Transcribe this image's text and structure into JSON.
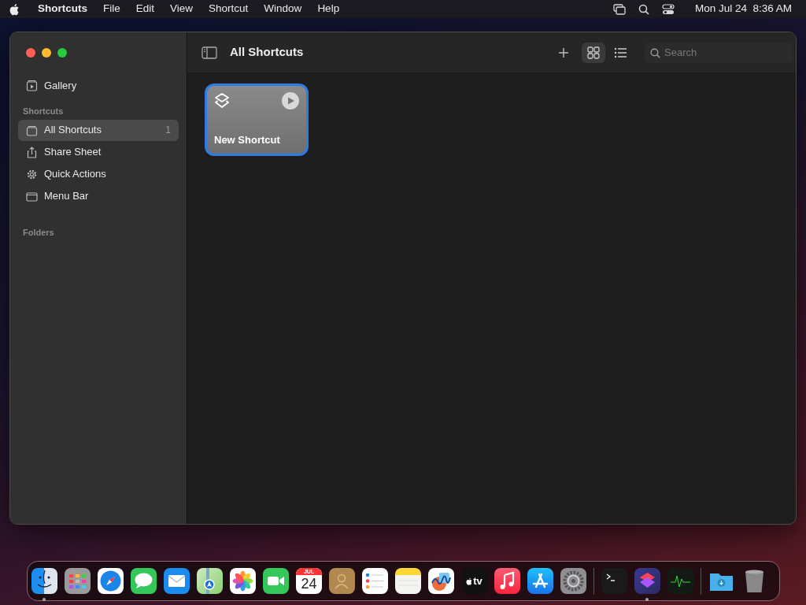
{
  "menu_bar": {
    "app": "Shortcuts",
    "menus": [
      "File",
      "Edit",
      "View",
      "Shortcut",
      "Window",
      "Help"
    ],
    "clock": "Mon Jul 24  8:36 AM"
  },
  "window": {
    "title": "All Shortcuts",
    "search": {
      "placeholder": "Search"
    },
    "view_modes": [
      {
        "kind": "grid",
        "selected": true
      },
      {
        "kind": "list",
        "selected": false
      }
    ]
  },
  "sidebar": [
    {
      "kind": "item",
      "label": "Gallery",
      "selected": false
    },
    {
      "kind": "heading",
      "label": "Shortcuts"
    },
    {
      "kind": "item",
      "label": "All Shortcuts",
      "count": "1",
      "selected": true
    },
    {
      "kind": "item",
      "label": "Share Sheet",
      "selected": false
    },
    {
      "kind": "item",
      "label": "Quick Actions",
      "selected": false
    },
    {
      "kind": "item",
      "label": "Menu Bar",
      "selected": false
    },
    {
      "kind": "heading",
      "label": "Folders"
    }
  ],
  "shortcuts": [
    {
      "name": "New Shortcut",
      "selected": true
    }
  ],
  "dock": [
    [
      {
        "kind": "finder",
        "running": true
      },
      {
        "kind": "launchpad",
        "running": false
      },
      {
        "kind": "safari",
        "running": false
      },
      {
        "kind": "messages",
        "running": false
      },
      {
        "kind": "mail",
        "running": false
      },
      {
        "kind": "maps",
        "running": false
      },
      {
        "kind": "photos",
        "running": false
      },
      {
        "kind": "facetime",
        "running": false
      },
      {
        "kind": "calendar",
        "month": "JUL",
        "day": "24",
        "running": false
      },
      {
        "kind": "contacts",
        "running": false
      },
      {
        "kind": "reminders",
        "running": false
      },
      {
        "kind": "notes",
        "running": false
      },
      {
        "kind": "freeform",
        "running": false
      },
      {
        "kind": "tv",
        "label": "tv",
        "running": false
      },
      {
        "kind": "music",
        "running": false
      },
      {
        "kind": "appstore",
        "running": false
      },
      {
        "kind": "settings",
        "running": false
      }
    ],
    [
      {
        "kind": "terminal",
        "running": false
      },
      {
        "kind": "shortcuts",
        "running": true
      },
      {
        "kind": "activity",
        "running": false
      }
    ],
    [
      {
        "kind": "downloads",
        "running": false
      },
      {
        "kind": "trash",
        "running": false
      }
    ]
  ]
}
